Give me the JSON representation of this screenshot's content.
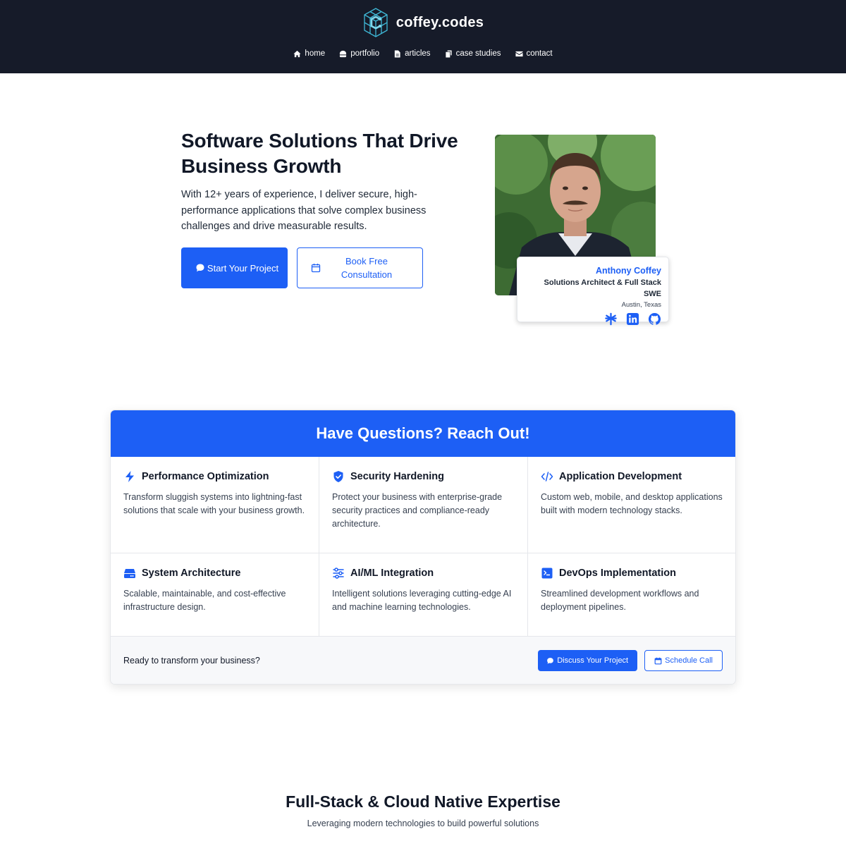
{
  "brand": {
    "name": "coffey.codes"
  },
  "nav": {
    "items": [
      {
        "label": "home",
        "icon": "home-icon"
      },
      {
        "label": "portfolio",
        "icon": "portfolio-icon"
      },
      {
        "label": "articles",
        "icon": "articles-icon"
      },
      {
        "label": "case studies",
        "icon": "case-studies-icon"
      },
      {
        "label": "contact",
        "icon": "envelope-icon"
      }
    ]
  },
  "hero": {
    "title": "Software Solutions That Drive Business Growth",
    "subtitle": "With 12+ years of experience, I deliver secure, high-performance applications that solve complex business challenges and drive measurable results.",
    "primary_cta": "Start Your Project",
    "secondary_cta": "Book Free Consultation"
  },
  "profile": {
    "name": "Anthony Coffey",
    "role": "Solutions Architect & Full Stack SWE",
    "location": "Austin, Texas",
    "links": [
      "linktree-icon",
      "linkedin-icon",
      "github-icon"
    ]
  },
  "services": {
    "title": "Have Questions? Reach Out!",
    "items": [
      {
        "title": "Performance Optimization",
        "icon": "lightning-icon",
        "description": "Transform sluggish systems into lightning-fast solutions that scale with your business growth."
      },
      {
        "title": "Security Hardening",
        "icon": "shield-icon",
        "description": "Protect your business with enterprise-grade security practices and compliance-ready architecture."
      },
      {
        "title": "Application Development",
        "icon": "code-icon",
        "description": "Custom web, mobile, and desktop applications built with modern technology stacks."
      },
      {
        "title": "System Architecture",
        "icon": "server-icon",
        "description": "Scalable, maintainable, and cost-effective infrastructure design."
      },
      {
        "title": "AI/ML Integration",
        "icon": "sliders-icon",
        "description": "Intelligent solutions leveraging cutting-edge AI and machine learning technologies."
      },
      {
        "title": "DevOps Implementation",
        "icon": "terminal-icon",
        "description": "Streamlined development workflows and deployment pipelines."
      }
    ],
    "footer_text": "Ready to transform your business?",
    "footer_primary": "Discuss Your Project",
    "footer_secondary": "Schedule Call"
  },
  "expertise": {
    "title": "Full-Stack & Cloud Native Expertise",
    "subtitle": "Leveraging modern technologies to build powerful solutions"
  },
  "colors": {
    "header_bg": "#161b29",
    "accent": "#1d5ff5",
    "logo_accent": "#3fb8d6"
  }
}
